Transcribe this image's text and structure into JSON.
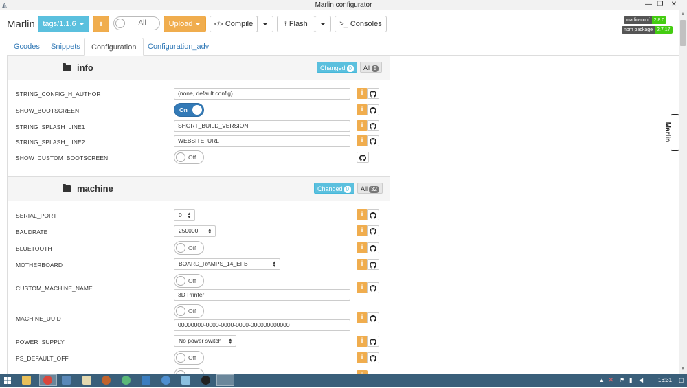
{
  "window": {
    "title": "Marlin configurator",
    "minimize": "—",
    "restore": "❐",
    "close": "✕"
  },
  "header": {
    "brand": "Marlin",
    "tags_button": "tags/1.1.6",
    "info_button": "i",
    "all_toggle": "All",
    "upload_button": "Upload",
    "compile_button": "Compile",
    "compile_icon": "</>",
    "flash_button": "Flash",
    "consoles_button": ">_ Consoles",
    "badges": [
      {
        "key": "marlin-conf",
        "value": "2.8.0"
      },
      {
        "key": "npm package",
        "value": "2.7.17"
      }
    ]
  },
  "tabs": [
    "Gcodes",
    "Snippets",
    "Configuration",
    "Configuration_adv"
  ],
  "active_tab": "Configuration",
  "sections": {
    "info": {
      "title": "info",
      "changed_label": "Changed",
      "changed_count": "0",
      "all_label": "All",
      "all_count": "5",
      "rows": [
        {
          "label": "STRING_CONFIG_H_AUTHOR",
          "value": "(none, default config)"
        },
        {
          "label": "SHOW_BOOTSCREEN",
          "value": "On"
        },
        {
          "label": "STRING_SPLASH_LINE1",
          "value": "SHORT_BUILD_VERSION"
        },
        {
          "label": "STRING_SPLASH_LINE2",
          "value": "WEBSITE_URL"
        },
        {
          "label": "SHOW_CUSTOM_BOOTSCREEN",
          "value": "Off"
        }
      ]
    },
    "machine": {
      "title": "machine",
      "changed_label": "Changed",
      "changed_count": "0",
      "all_label": "All",
      "all_count": "32",
      "rows": [
        {
          "label": "SERIAL_PORT",
          "value": "0"
        },
        {
          "label": "BAUDRATE",
          "value": "250000"
        },
        {
          "label": "BLUETOOTH",
          "value": "Off"
        },
        {
          "label": "MOTHERBOARD",
          "value": "BOARD_RAMPS_14_EFB"
        },
        {
          "label": "CUSTOM_MACHINE_NAME",
          "value": "Off",
          "field": "3D Printer"
        },
        {
          "label": "MACHINE_UUID",
          "value": "Off",
          "field": "00000000-0000-0000-0000-000000000000"
        },
        {
          "label": "POWER_SUPPLY",
          "value": "No power switch"
        },
        {
          "label": "PS_DEFAULT_OFF",
          "value": "Off"
        }
      ]
    }
  },
  "side_mark": "Marlin",
  "taskbar": {
    "clock": "16:31"
  },
  "colors": {
    "info_blue": "#5bc0de",
    "warning_orange": "#f0ad4e",
    "primary_blue": "#337ab7",
    "taskbar": "#3a5f7a"
  }
}
